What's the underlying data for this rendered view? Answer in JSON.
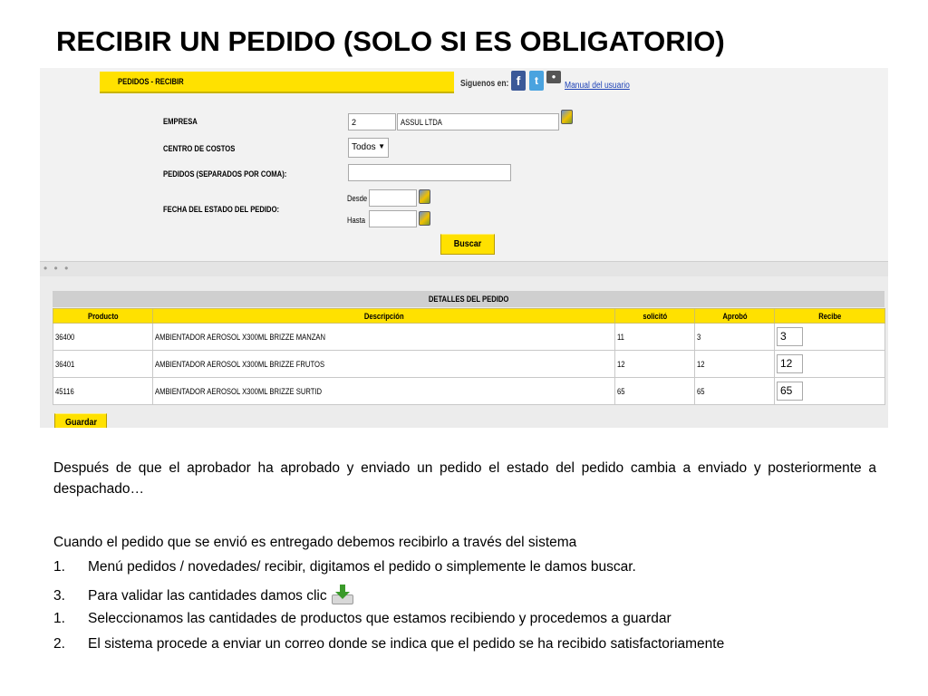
{
  "slide": {
    "title": "RECIBIR UN PEDIDO (SOLO SI ES OBLIGATORIO)"
  },
  "app": {
    "tab_title": "PEDIDOS - RECIBIR",
    "follow_label": "Siguenos en:",
    "social_icons": [
      "facebook-icon",
      "twitter-icon",
      "other-social-icon"
    ],
    "manual_link": "Manual del usuario",
    "form": {
      "empresa_label": "EMPRESA",
      "empresa_code": "2",
      "empresa_name": "ASSUL LTDA",
      "centro_label": "CENTRO DE COSTOS",
      "centro_value": "Todos",
      "pedidos_label": "PEDIDOS (SEPARADOS POR COMA):",
      "pedidos_value": "",
      "fecha_label": "FECHA DEL ESTADO DEL PEDIDO:",
      "desde_label": "Desde",
      "hasta_label": "Hasta",
      "desde_value": "",
      "hasta_value": "",
      "search_button": "Buscar"
    },
    "details": {
      "title": "DETALLES DEL PEDIDO",
      "columns": [
        "Producto",
        "Descripción",
        "solicitó",
        "Aprobó",
        "Recibe"
      ],
      "rows": [
        {
          "producto": "36400",
          "descripcion": "AMBIENTADOR AEROSOL X300ML BRIZZE MANZAN",
          "solicito": "11",
          "aprobo": "3",
          "recibe": "3"
        },
        {
          "producto": "36401",
          "descripcion": "AMBIENTADOR AEROSOL X300ML BRIZZE FRUTOS",
          "solicito": "12",
          "aprobo": "12",
          "recibe": "12"
        },
        {
          "producto": "45116",
          "descripcion": "AMBIENTADOR AEROSOL X300ML BRIZZE SURTID",
          "solicito": "65",
          "aprobo": "65",
          "recibe": "65"
        }
      ],
      "save_button": "Guardar"
    },
    "colors": {
      "accent_yellow": "#ffe100",
      "link_blue": "#1a3fb5",
      "panel_gray": "#f2f2f2"
    }
  },
  "text": {
    "p1": "Después de que el aprobador ha aprobado y enviado un pedido el estado del pedido cambia a enviado y posteriormente a despachado…",
    "p2": "Cuando el pedido que se envió es entregado debemos recibirlo a través del sistema",
    "items": [
      {
        "num": "1.",
        "text": "Menú pedidos / novedades/ recibir, digitamos  el pedido  o simplemente le damos buscar."
      },
      {
        "num": "3.",
        "text": "Para validar las cantidades damos clic"
      },
      {
        "num": "1.",
        "text": "Seleccionamos las cantidades de productos que estamos recibiendo y procedemos a guardar"
      },
      {
        "num": "2.",
        "text": "El sistema procede a enviar un correo donde se indica que el pedido se ha recibido satisfactoriamente"
      }
    ],
    "inline_icon": "download-icon"
  }
}
